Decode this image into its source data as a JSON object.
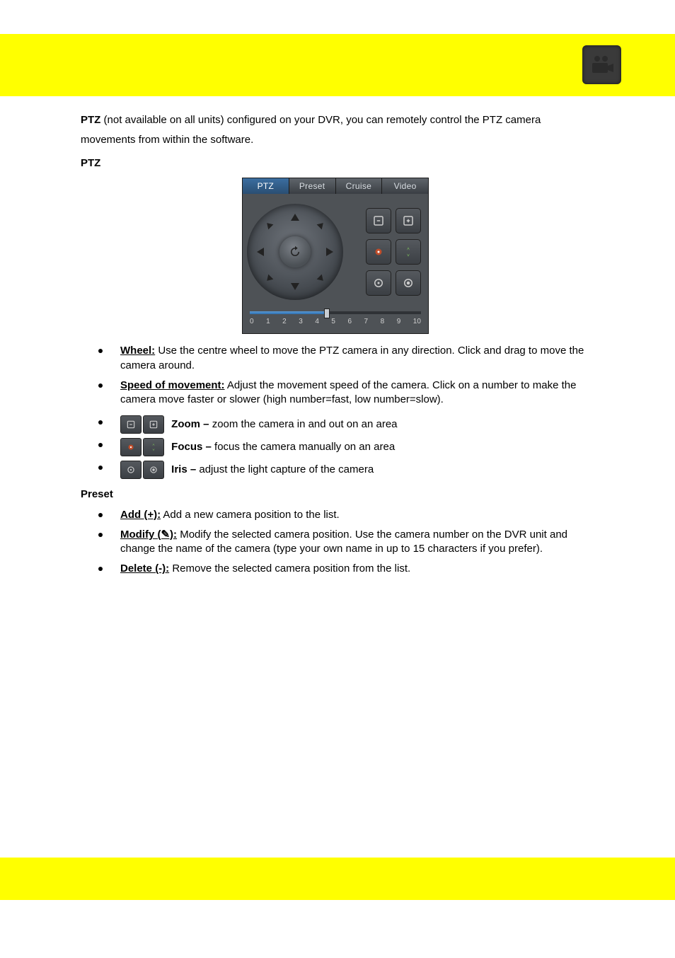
{
  "shot": {
    "tabs": [
      "PTZ",
      "Preset",
      "Cruise",
      "Video"
    ],
    "active_tab": 0,
    "slider": {
      "value": 5,
      "ticks": [
        "0",
        "1",
        "2",
        "3",
        "4",
        "5",
        "6",
        "7",
        "8",
        "9",
        "10"
      ]
    }
  },
  "intro": {
    "line1": " (not available on all units) configured on your DVR, you can remotely control the PTZ camera",
    "line1_prefix": "PTZ",
    "line2": "movements from within the software."
  },
  "section1": {
    "heading": "PTZ",
    "items": [
      {
        "label": "Wheel:",
        "body": "Use the centre wheel to move the PTZ camera in any direction. Click and drag to move the camera around."
      },
      {
        "label": "Speed of movement:",
        "body": "Adjust the movement speed of the camera. Click on a number to make the camera move faster or slower (high number=fast, low number=slow)."
      }
    ],
    "icon_items": [
      {
        "label": "Zoom ",
        "dash": "– ",
        "tail": "zoom the camera in and out on an area"
      },
      {
        "label": "Focus – ",
        "single": true,
        "tail": "focus the camera manually on an area"
      },
      {
        "label": "Iris – ",
        "tail": "adjust the light capture of the camera"
      }
    ]
  },
  "section2": {
    "heading": "Preset",
    "items": [
      {
        "label": "Add (+):",
        "body": "Add a new camera position to the list."
      },
      {
        "label": "Modify (✎):",
        "body_part1": "Modify the selected camera position. Use the camera number on the DVR unit and change the name of the camera (type your own name in up to 15 characters if you prefer).",
        "body_part2": ""
      },
      {
        "label": "Delete (‑):",
        "body": "Remove the selected camera position from the list."
      }
    ]
  }
}
